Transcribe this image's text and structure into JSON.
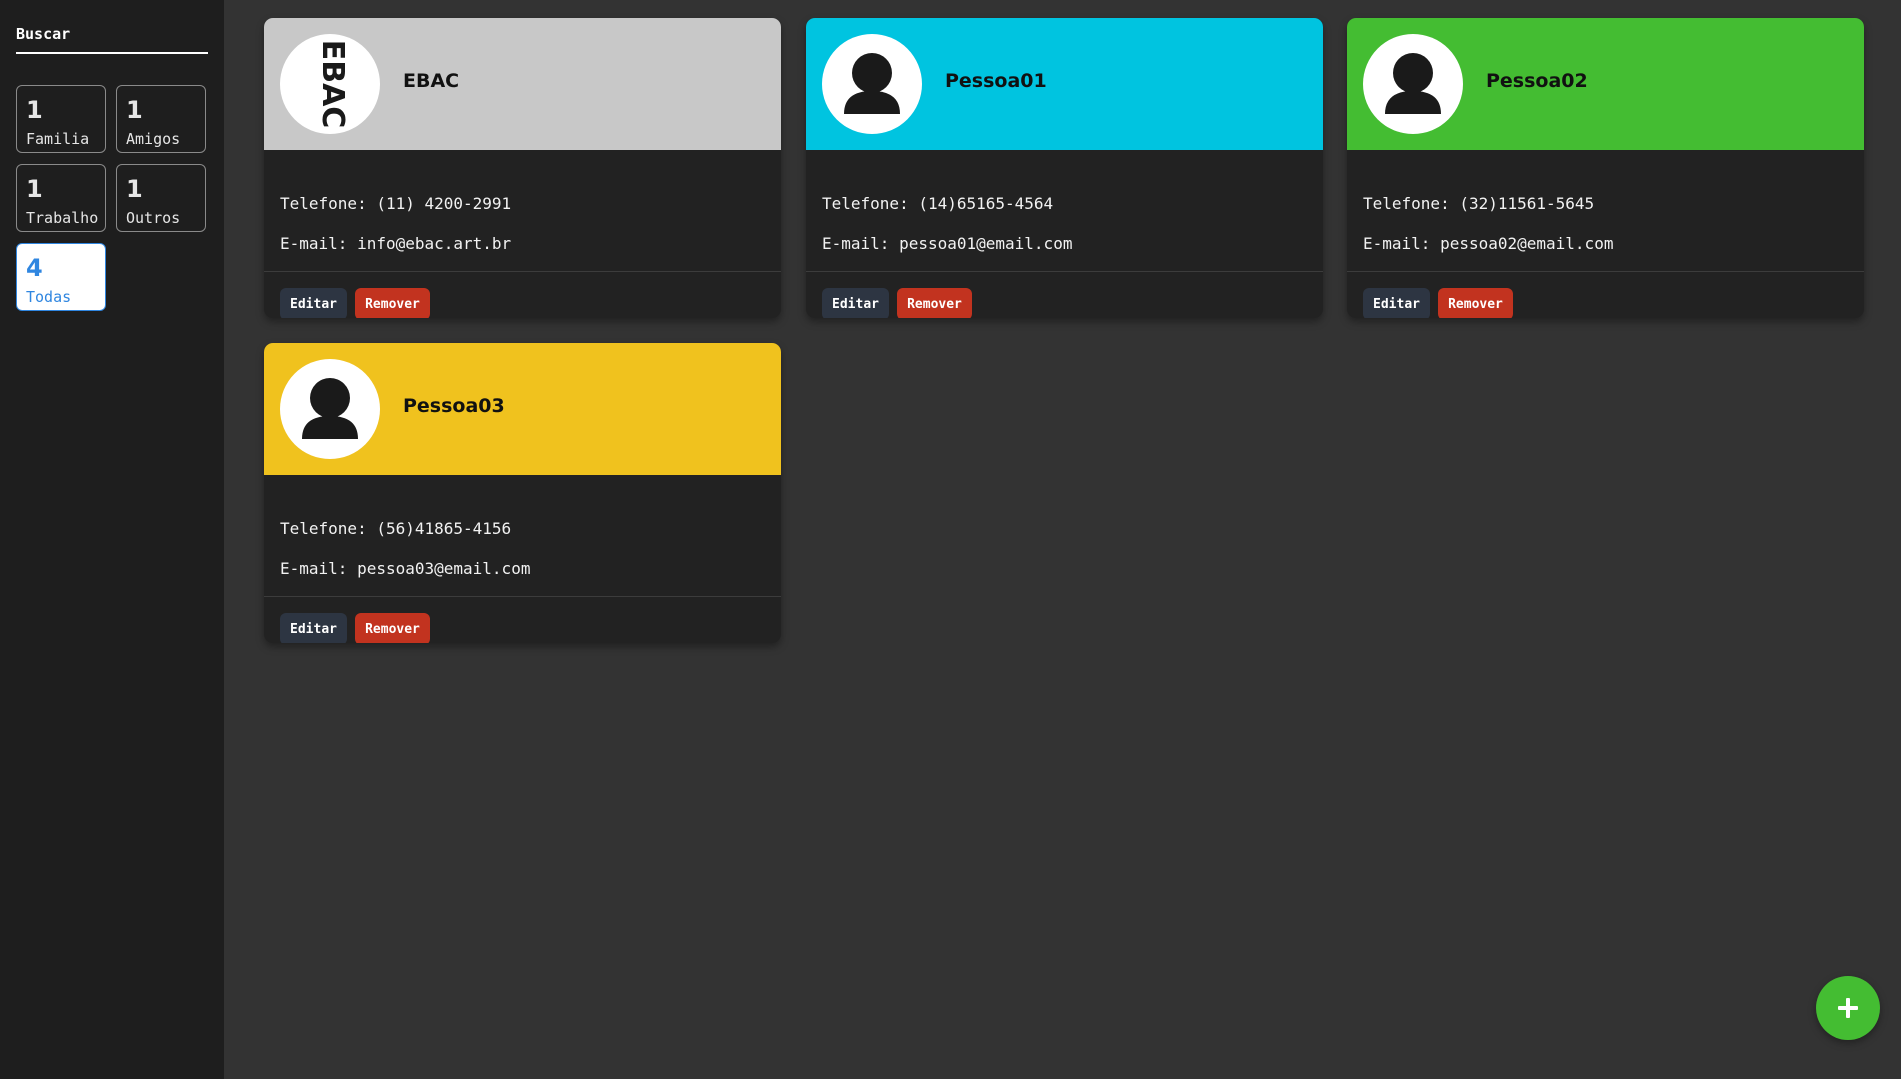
{
  "sidebar": {
    "search": {
      "placeholder": "Buscar"
    },
    "filters": [
      {
        "count": "1",
        "label": "Familia",
        "active": false
      },
      {
        "count": "1",
        "label": "Amigos",
        "active": false
      },
      {
        "count": "1",
        "label": "Trabalho",
        "active": false
      },
      {
        "count": "1",
        "label": "Outros",
        "active": false
      },
      {
        "count": "4",
        "label": "Todas",
        "active": true
      }
    ]
  },
  "contacts": [
    {
      "name": "EBAC",
      "phone": "Telefone: (11) 4200-2991",
      "email": "E-mail: info@ebac.art.br",
      "header_color": "#c8c8c8",
      "avatar_icon": "ebac-logo-icon",
      "logo_text": "EBAC"
    },
    {
      "name": "Pessoa01",
      "phone": "Telefone: (14)65165-4564",
      "email": "E-mail: pessoa01@email.com",
      "header_color": "#00c4e0",
      "avatar_icon": "person-icon"
    },
    {
      "name": "Pessoa02",
      "phone": "Telefone: (32)11561-5645",
      "email": "E-mail: pessoa02@email.com",
      "header_color": "#44bd32",
      "avatar_icon": "person-icon"
    },
    {
      "name": "Pessoa03",
      "phone": "Telefone: (56)41865-4156",
      "email": "E-mail: pessoa03@email.com",
      "header_color": "#f0c21e",
      "avatar_icon": "person-icon"
    }
  ],
  "buttons": {
    "edit_label": "Editar",
    "remove_label": "Remover"
  },
  "fab": {
    "icon": "plus-icon",
    "color": "#44bd32"
  },
  "colors": {
    "sidebar_bg": "#1e1e1e",
    "page_bg": "#333333",
    "card_body_bg": "#222222",
    "edit_button": "#2d3542",
    "remove_button": "#c2331f",
    "active_filter": "#2f86e0"
  }
}
